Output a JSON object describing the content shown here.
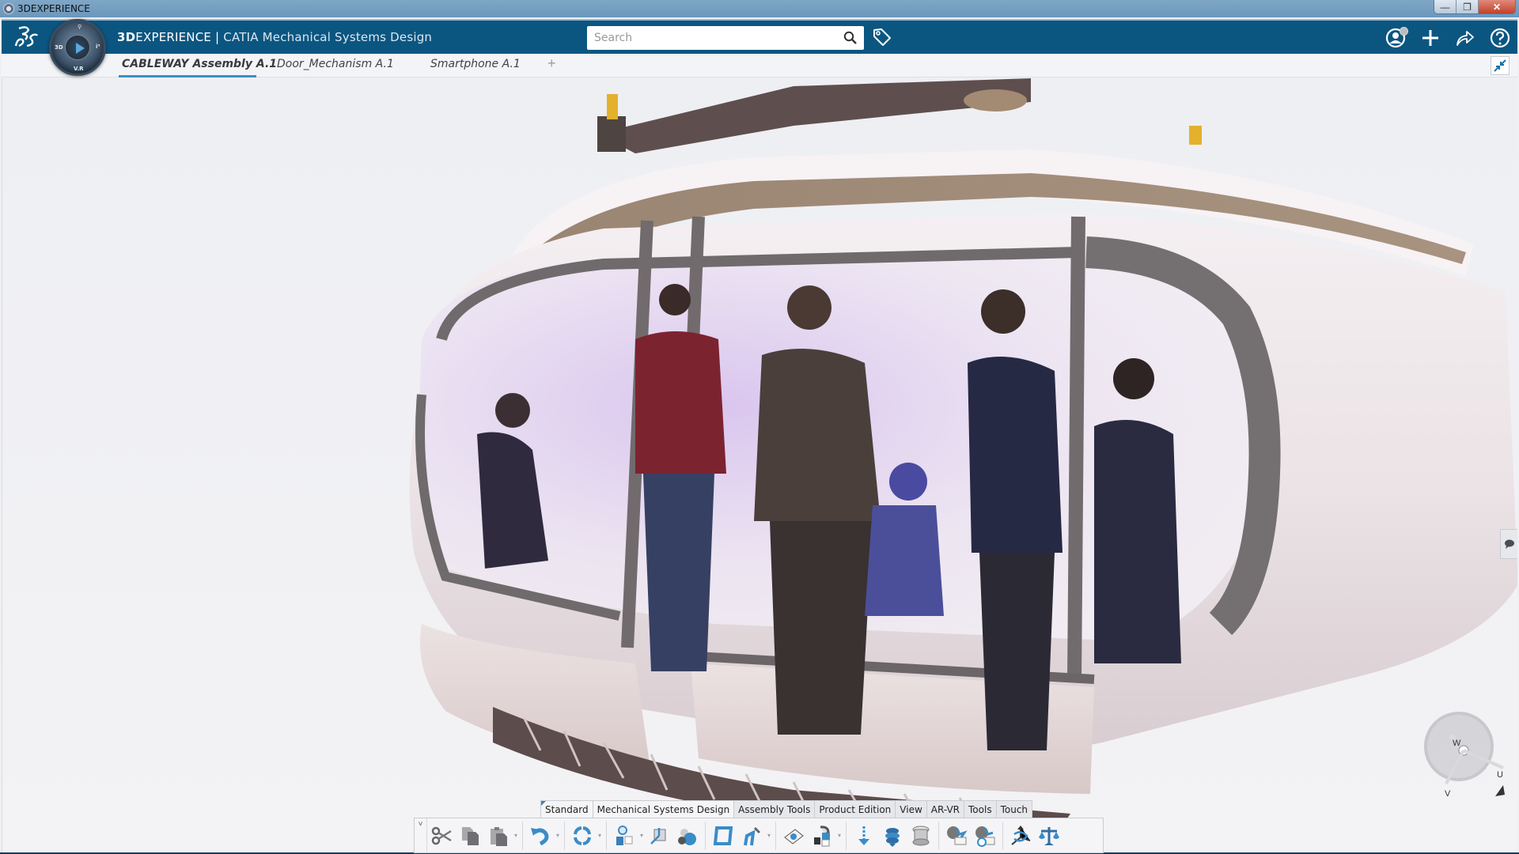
{
  "window": {
    "title": "3DEXPERIENCE",
    "controls": {
      "minimize": "—",
      "maximize": "❐",
      "close": "✕"
    }
  },
  "header": {
    "brand_bold": "3D",
    "brand_rest": "EXPERIENCE",
    "separator": " | ",
    "app_name": "CATIA Mechanical Systems Design",
    "compass_labels": {
      "left": "3D",
      "right": "i³",
      "bottom": "V.R",
      "top": "⚲"
    },
    "search": {
      "placeholder": "Search",
      "value": ""
    },
    "icons": [
      "tag-icon",
      "user-icon",
      "add-icon",
      "share-icon",
      "help-icon"
    ]
  },
  "tabs": [
    {
      "label": "CABLEWAY Assembly A.1",
      "active": true
    },
    {
      "label": "Door_Mechanism A.1",
      "active": false
    },
    {
      "label": "Smartphone A.1",
      "active": false
    }
  ],
  "tab_add_label": "+",
  "viewport": {
    "model": "Cableway cabin with passengers",
    "compass_axes": {
      "u": "U",
      "v": "V",
      "w": "W"
    }
  },
  "section_tabs": [
    {
      "label": "Standard",
      "active": true
    },
    {
      "label": "Mechanical Systems Design",
      "active": false
    },
    {
      "label": "Assembly Tools",
      "active": false
    },
    {
      "label": "Product Edition",
      "active": false
    },
    {
      "label": "View",
      "active": false
    },
    {
      "label": "AR-VR",
      "active": false
    },
    {
      "label": "Tools",
      "active": false
    },
    {
      "label": "Touch",
      "active": false
    }
  ],
  "action_bar": {
    "collapse": "˅",
    "tools": [
      "cut-icon",
      "copy-icon",
      "paste-icon",
      "undo-icon",
      "update-icon",
      "engineering-connection-icon",
      "manipulate-icon",
      "assembly-spheres-icon",
      "mechanism-icon",
      "joint-icon",
      "clash-icon",
      "robot-icon",
      "gravity-icon",
      "spring-icon",
      "bushing-icon",
      "contact-icon",
      "contact-exclude-icon",
      "axis-system-icon",
      "balance-icon"
    ]
  },
  "colors": {
    "topbar": "#0b5681",
    "tab_accent": "#3b8fc6",
    "viewport_bg": "#eeeff3",
    "cabin_shell": "#e8e2e6",
    "cabin_frame": "#6f6a6c",
    "wood_band": "#9f8c78",
    "interior_glow": "#cbb2e8"
  }
}
